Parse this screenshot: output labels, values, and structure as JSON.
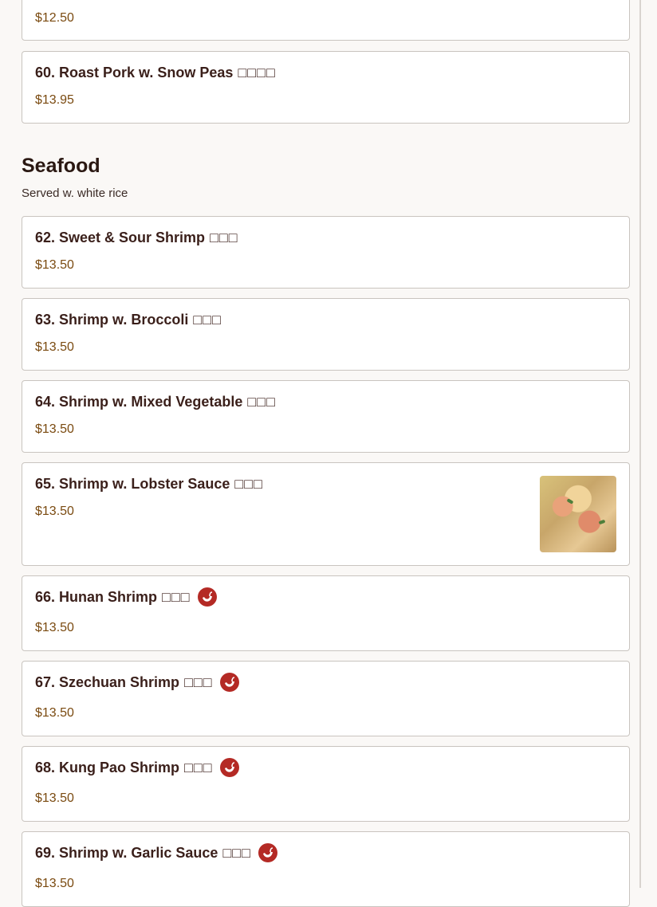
{
  "top_partial": {
    "price": "$12.50"
  },
  "item60": {
    "name": "60. Roast Pork w. Snow Peas",
    "zh": "□□□□",
    "price": "$13.95"
  },
  "section": {
    "title": "Seafood",
    "subtitle": "Served w. white rice"
  },
  "items": [
    {
      "name": "62. Sweet & Sour Shrimp",
      "zh": "□□□",
      "price": "$13.50",
      "spicy": false
    },
    {
      "name": "63. Shrimp w. Broccoli",
      "zh": "□□□",
      "price": "$13.50",
      "spicy": false
    },
    {
      "name": "64. Shrimp w. Mixed Vegetable",
      "zh": "□□□",
      "price": "$13.50",
      "spicy": false
    },
    {
      "name": "65. Shrimp w. Lobster Sauce",
      "zh": "□□□",
      "price": "$13.50",
      "spicy": false,
      "has_image": true
    },
    {
      "name": "66. Hunan Shrimp",
      "zh": "□□□",
      "price": "$13.50",
      "spicy": true
    },
    {
      "name": "67. Szechuan Shrimp",
      "zh": "□□□",
      "price": "$13.50",
      "spicy": true
    },
    {
      "name": "68. Kung Pao Shrimp",
      "zh": "□□□",
      "price": "$13.50",
      "spicy": true
    },
    {
      "name": "69. Shrimp w. Garlic Sauce",
      "zh": "□□□",
      "price": "$13.50",
      "spicy": true
    }
  ],
  "icons": {
    "spicy": "chili-pepper-icon",
    "dish_photo": "shrimp-lobster-sauce-photo"
  },
  "colors": {
    "price": "#7a4a10",
    "spicy_badge": "#b42a25",
    "text": "#3a1f1a"
  }
}
